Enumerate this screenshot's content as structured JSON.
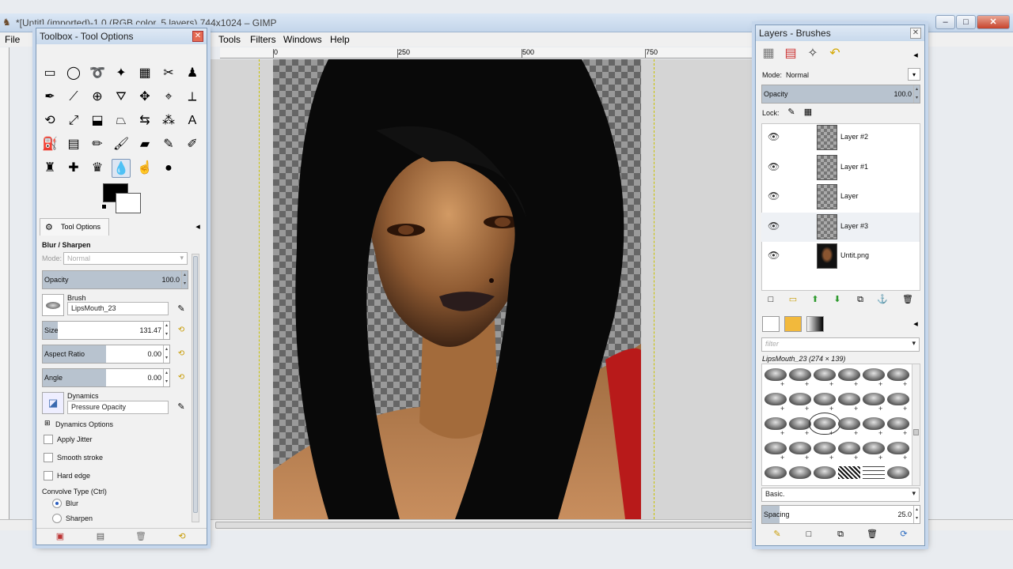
{
  "window": {
    "title": "*[Untit] (imported)-1.0 (RGB color, 5 layers) 744x1024 – GIMP",
    "buttons": {
      "min": "–",
      "max": "□",
      "close": "✕"
    }
  },
  "menu": {
    "file": "File",
    "tools": "Tools",
    "filters": "Filters",
    "windows": "Windows",
    "help": "Help"
  },
  "ruler": {
    "t0": "0",
    "t250": "250",
    "t500": "500",
    "t750": "750"
  },
  "toolbox": {
    "title": "Toolbox - Tool Options",
    "close": "✕",
    "tools": [
      {
        "icon": "rect-select-icon",
        "glyph": "▭"
      },
      {
        "icon": "ellipse-select-icon",
        "glyph": "◯"
      },
      {
        "icon": "lasso-icon",
        "glyph": "➰"
      },
      {
        "icon": "fuzzy-select-icon",
        "glyph": "✦"
      },
      {
        "icon": "color-select-icon",
        "glyph": "▦"
      },
      {
        "icon": "scissors-icon",
        "glyph": "✂"
      },
      {
        "icon": "foreground-select-icon",
        "glyph": "♟"
      },
      {
        "icon": "paths-icon",
        "glyph": "✒"
      },
      {
        "icon": "color-picker-icon",
        "glyph": "⟋"
      },
      {
        "icon": "zoom-icon",
        "glyph": "⊕"
      },
      {
        "icon": "measure-icon",
        "glyph": "⛛"
      },
      {
        "icon": "move-icon",
        "glyph": "✥"
      },
      {
        "icon": "align-icon",
        "glyph": "⌖"
      },
      {
        "icon": "crop-icon",
        "glyph": "⟂"
      },
      {
        "icon": "rotate-icon",
        "glyph": "⟲"
      },
      {
        "icon": "scale-icon",
        "glyph": "⤢"
      },
      {
        "icon": "shear-icon",
        "glyph": "⬓"
      },
      {
        "icon": "perspective-icon",
        "glyph": "⏢"
      },
      {
        "icon": "flip-icon",
        "glyph": "⇆"
      },
      {
        "icon": "cage-icon",
        "glyph": "⁂"
      },
      {
        "icon": "text-icon",
        "glyph": "A"
      },
      {
        "icon": "bucket-fill-icon",
        "glyph": "⛽"
      },
      {
        "icon": "blend-icon",
        "glyph": "▤"
      },
      {
        "icon": "pencil-icon",
        "glyph": "✏"
      },
      {
        "icon": "paintbrush-icon",
        "glyph": "🖌"
      },
      {
        "icon": "eraser-icon",
        "glyph": "▰"
      },
      {
        "icon": "airbrush-icon",
        "glyph": "✎"
      },
      {
        "icon": "ink-icon",
        "glyph": "✐"
      },
      {
        "icon": "clone-icon",
        "glyph": "♜"
      },
      {
        "icon": "heal-icon",
        "glyph": "✚"
      },
      {
        "icon": "perspective-clone-icon",
        "glyph": "♛"
      },
      {
        "icon": "blur-sharpen-icon",
        "glyph": "💧"
      },
      {
        "icon": "smudge-icon",
        "glyph": "☝"
      },
      {
        "icon": "dodge-burn-icon",
        "glyph": "●"
      }
    ],
    "tab_label": "Tool Options",
    "tool_name": "Blur / Sharpen",
    "mode_label": "Mode:",
    "mode_value": "Normal",
    "opacity": {
      "label": "Opacity",
      "value": "100.0",
      "fraction": 1.0
    },
    "brush": {
      "label": "Brush",
      "value": "LipsMouth_23"
    },
    "size": {
      "label": "Size",
      "value": "131.47",
      "fraction": 0.12
    },
    "aspect": {
      "label": "Aspect Ratio",
      "value": "0.00",
      "fraction": 0.5
    },
    "angle": {
      "label": "Angle",
      "value": "0.00",
      "fraction": 0.5
    },
    "dynamics": {
      "label": "Dynamics",
      "value": "Pressure Opacity"
    },
    "dynamics_options": "Dynamics Options",
    "apply_jitter": "Apply Jitter",
    "smooth_stroke": "Smooth stroke",
    "hard_edge": "Hard edge",
    "convolve_type": "Convolve Type  (Ctrl)",
    "blur": "Blur",
    "sharpen": "Sharpen"
  },
  "layers": {
    "title": "Layers - Brushes",
    "close": "✕",
    "mode_label": "Mode:",
    "mode_value": "Normal",
    "opacity_label": "Opacity",
    "opacity_value": "100.0",
    "lock_label": "Lock:",
    "items": [
      {
        "name": "Layer #2"
      },
      {
        "name": "Layer #1"
      },
      {
        "name": "Layer"
      },
      {
        "name": "Layer #3"
      },
      {
        "name": "Untit.png"
      }
    ]
  },
  "brushes": {
    "filter_placeholder": "filter",
    "selected": "LipsMouth_23 (274 × 139)",
    "preset": "Basic.",
    "spacing_label": "Spacing",
    "spacing_value": "25.0"
  },
  "colors": {
    "accent": "#b8c3cf",
    "title_bar": "#c8d9ec",
    "foreground": "#000000",
    "background": "#ffffff"
  }
}
